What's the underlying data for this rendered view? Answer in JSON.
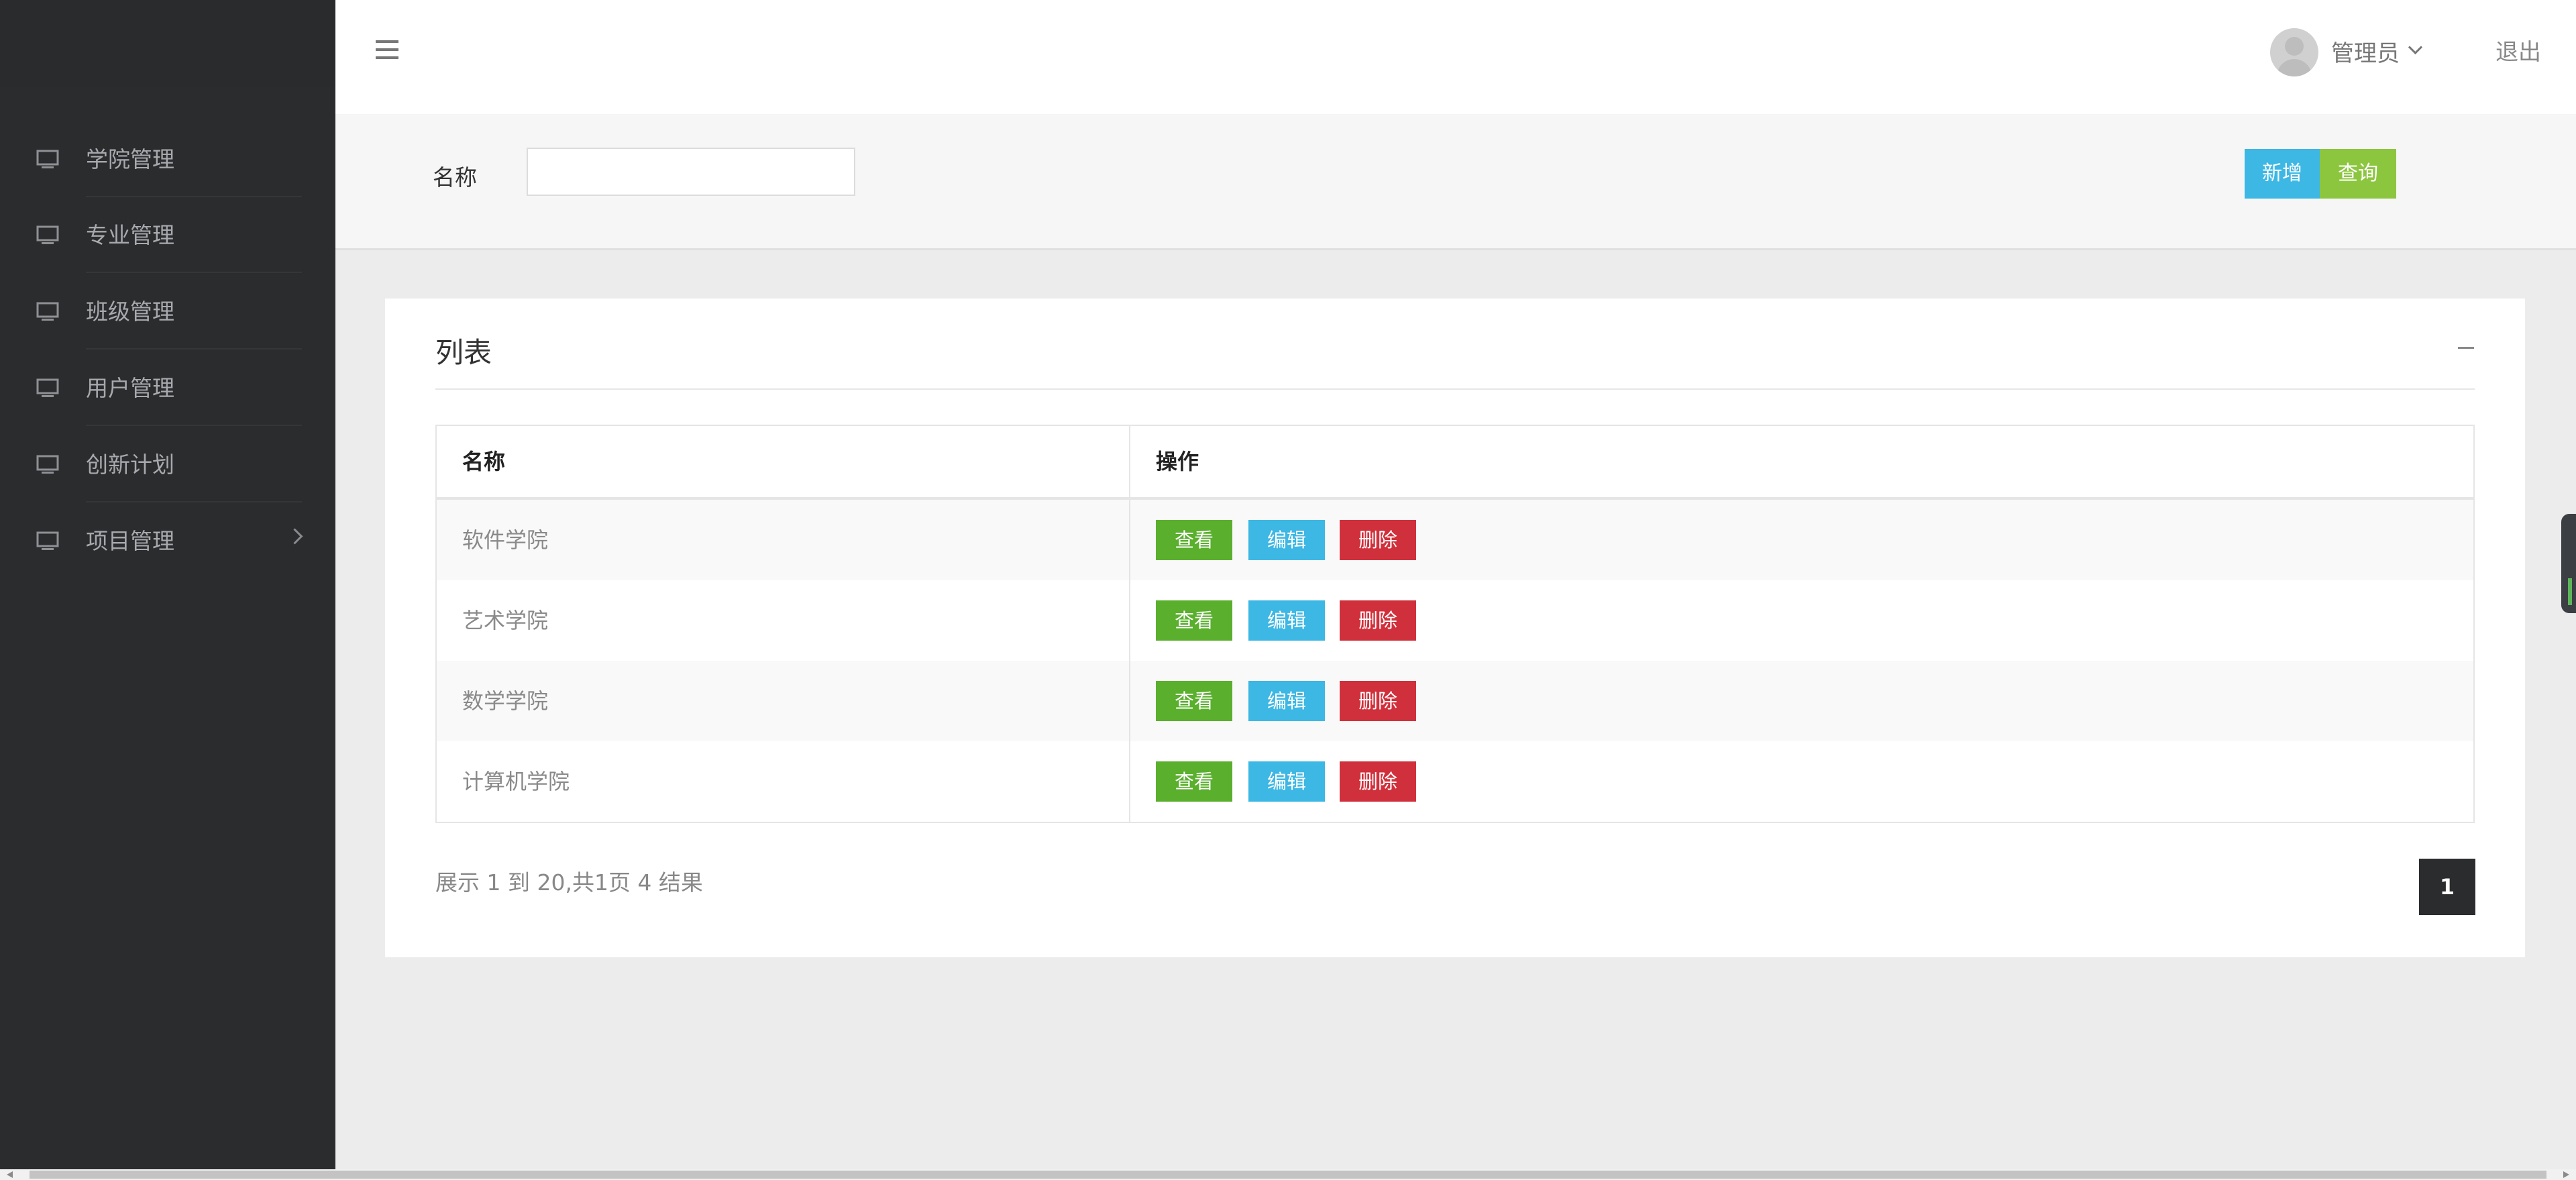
{
  "sidebar": {
    "items": [
      {
        "label": "学院管理",
        "icon": "monitor-icon"
      },
      {
        "label": "专业管理",
        "icon": "monitor-icon"
      },
      {
        "label": "班级管理",
        "icon": "monitor-icon"
      },
      {
        "label": "用户管理",
        "icon": "monitor-icon"
      },
      {
        "label": "创新计划",
        "icon": "monitor-icon"
      },
      {
        "label": "项目管理",
        "icon": "monitor-icon",
        "has_submenu": true
      }
    ]
  },
  "header": {
    "menu_icon": "hamburger-icon",
    "user_name": "管理员",
    "logout_label": "退出"
  },
  "search": {
    "label": "名称",
    "value": "",
    "add_label": "新增",
    "query_label": "查询"
  },
  "list": {
    "title": "列表",
    "columns": [
      "名称",
      "操作"
    ],
    "rows": [
      {
        "name": "软件学院"
      },
      {
        "name": "艺术学院"
      },
      {
        "name": "数学学院"
      },
      {
        "name": "计算机学院"
      }
    ],
    "actions": {
      "view": "查看",
      "edit": "编辑",
      "delete": "删除"
    },
    "summary": "展示 1 到 20,共1页 4 结果",
    "current_page": "1"
  },
  "colors": {
    "sidebar_bg": "#2b2c2e",
    "add_button": "#3db7e4",
    "query_button": "#8cc63f",
    "view_button": "#5aaf2d",
    "edit_button": "#3db7e4",
    "delete_button": "#d0303b"
  }
}
